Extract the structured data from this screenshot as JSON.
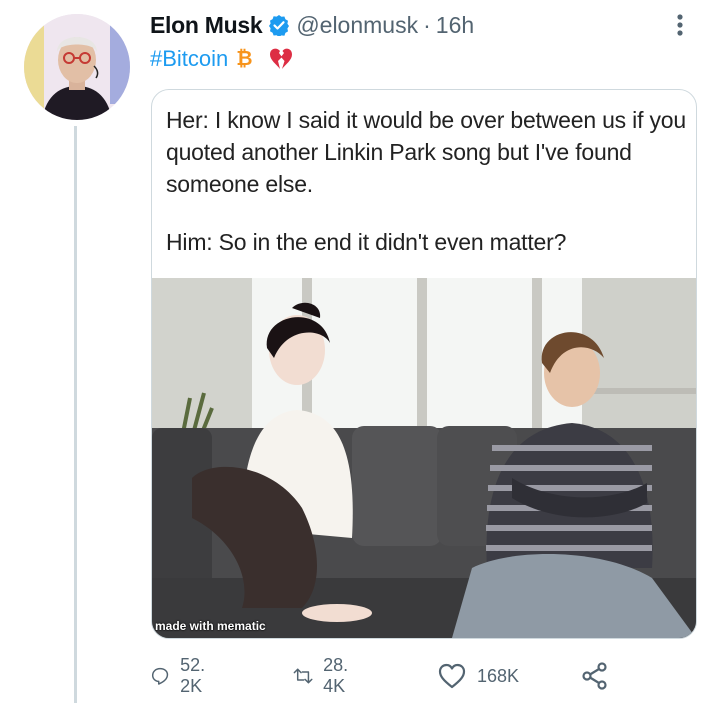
{
  "tweet": {
    "author_name": "Elon Musk",
    "handle": "@elonmusk",
    "separator": "·",
    "time": "16h",
    "hashtag": "#Bitcoin",
    "bitcoin_symbol": "₿"
  },
  "media": {
    "lines": [
      "Her: I know I said it would be over between us if you quoted another Linkin Park song but I've found someone else.",
      "Him: So in the end it didn't even matter?"
    ],
    "watermark": "made with mematic"
  },
  "actions": {
    "replies": "52. 2K",
    "retweets": "28. 4K",
    "likes": "168K"
  },
  "colors": {
    "accent": "#1d9bf0",
    "bitcoin": "#f7931a",
    "broken_heart": "#dd2e44",
    "muted": "#536471"
  },
  "icons": [
    "verified-badge-icon",
    "more-options-icon",
    "broken-heart-icon",
    "reply-icon",
    "retweet-icon",
    "like-icon",
    "share-icon"
  ]
}
